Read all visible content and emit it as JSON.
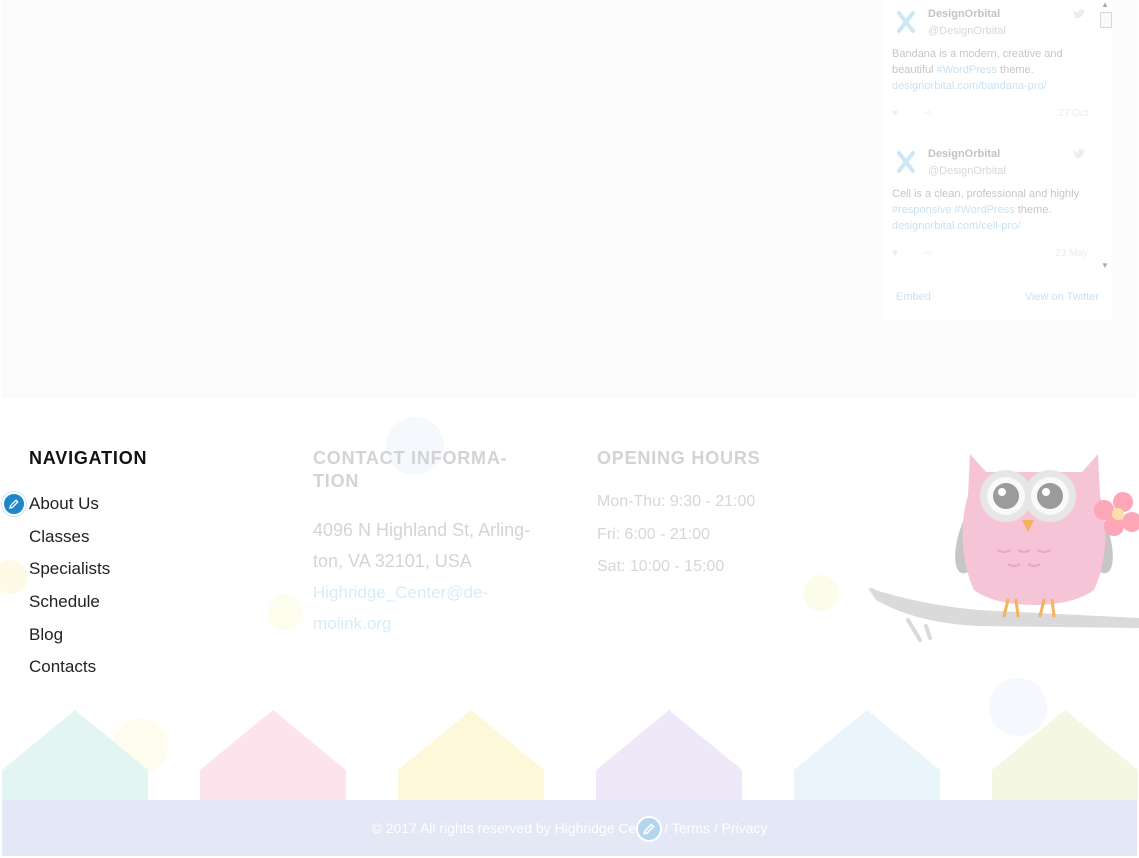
{
  "twitter_widget": {
    "tweets": [
      {
        "author": "DesignOrbital",
        "handle": "@DesignOrbital",
        "text_before": "Bandana is a modern, creative and beautiful ",
        "hashtags": "#WordPress",
        "text_after": " theme.",
        "link": "designorbital.com/bandana-pro/",
        "time": "27 Oct"
      },
      {
        "author": "DesignOrbital",
        "handle": "@DesignOrbital",
        "text_before": "Cell is a clean, professional and highly ",
        "hashtags": "#responsive #WordPress",
        "text_after": " theme.",
        "link": "designorbital.com/cell-pro/",
        "time": "23 May"
      }
    ],
    "embed_label": "Embed",
    "view_on_twitter_label": "View on Twitter"
  },
  "footer": {
    "navigation": {
      "title": "NAVIGATION",
      "items": [
        "About Us",
        "Classes",
        "Specialists",
        "Schedule",
        "Blog",
        "Contacts"
      ]
    },
    "contact": {
      "title": "CONTACT INFORMA-TION",
      "address": "4096 N Highland St, Arling-ton, VA 32101, USA",
      "email": "Highridge_Center@de-molink.org"
    },
    "hours": {
      "title": "OPENING HOURS",
      "items": [
        "Mon-Thu: 9:30 - 21:00",
        "Fri: 6:00 - 21:00",
        "Sat: 10:00 - 15:00"
      ]
    },
    "copyright": "© 2017 All rights reserved by Highridge Center / Terms / Privacy"
  },
  "colors": {
    "accent_blue": "#1e86c9",
    "copyright_bar": "#e4e7f5",
    "house_colors": [
      "#e3f5f2",
      "#fde3ec",
      "#fdf8d9",
      "#efe8f8",
      "#e9f4fb",
      "#f4f8e3"
    ]
  }
}
